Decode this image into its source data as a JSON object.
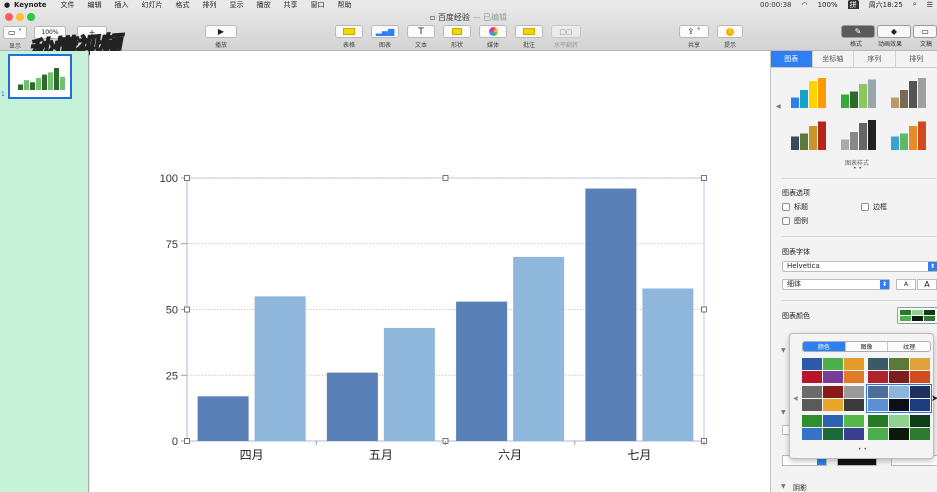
{
  "menubar": {
    "app": "Keynote",
    "items": [
      "文件",
      "编辑",
      "插入",
      "幻灯片",
      "格式",
      "排列",
      "显示",
      "播放",
      "共享",
      "窗口",
      "帮助"
    ],
    "status_time": "00:00:38",
    "battery": "100%",
    "input_method": "拼",
    "clock": "周六18:25"
  },
  "toolbar": {
    "view_label": "显示",
    "zoom_value": "100%",
    "play_label": "播放",
    "table_label": "表格",
    "chart_label": "图表",
    "text_label": "文本",
    "shape_label": "形状",
    "media_label": "媒体",
    "comment_label": "批注",
    "guides_label": "水平翻转",
    "share_label": "共享",
    "tips_label": "提示",
    "format_label": "格式",
    "animate_label": "动画效果",
    "document_label": "文稿"
  },
  "document": {
    "title": "百度经验",
    "edited": "— 已编辑"
  },
  "watermark": "秒懂视频",
  "slide_number": "1",
  "chart_data": {
    "type": "bar",
    "categories": [
      "四月",
      "五月",
      "六月",
      "七月"
    ],
    "series": [
      {
        "values": [
          17,
          26,
          53,
          96
        ]
      },
      {
        "values": [
          55,
          43,
          70,
          58
        ]
      }
    ],
    "yticks": [
      0,
      25,
      50,
      75,
      100
    ],
    "ylim": [
      0,
      100
    ],
    "colors": [
      "#5a80b8",
      "#8fb7db"
    ],
    "grid": true
  },
  "thumbnail_bars": [
    {
      "h": 0.25,
      "color": "#2c6b2c"
    },
    {
      "h": 0.45,
      "color": "#70c170"
    },
    {
      "h": 0.35,
      "color": "#2c6b2c"
    },
    {
      "h": 0.55,
      "color": "#70c170"
    },
    {
      "h": 0.7,
      "color": "#2c6b2c"
    },
    {
      "h": 0.8,
      "color": "#70c170"
    },
    {
      "h": 1.0,
      "color": "#2c6b2c"
    },
    {
      "h": 0.6,
      "color": "#70c170"
    }
  ],
  "inspector": {
    "tabs": [
      "图表",
      "坐标轴",
      "序列",
      "排列"
    ],
    "styles_caption": "图表样式",
    "options_title": "图表选项",
    "opt_title": "标题",
    "opt_border": "边框",
    "opt_legend": "图例",
    "font_title": "图表字体",
    "font_name": "Helvetica",
    "font_style": "细体",
    "font_small": "A",
    "font_large": "A",
    "color_title": "图表颜色",
    "shadow_label": "阴影"
  },
  "color_popover": {
    "tabs": [
      "颜色",
      "图像",
      "纹理"
    ],
    "palettes": [
      [
        "#2d5aa8",
        "#4caf4c",
        "#e39b2a",
        "#b5162b",
        "#7a3d97",
        "#e07c29"
      ],
      [
        "#3c5a66",
        "#5b7a3a",
        "#e0a23a",
        "#b0232a",
        "#7d1e1e",
        "#d24b1e"
      ],
      [
        "#6c6c6c",
        "#8a1a1a",
        "#9a9a9a",
        "#5a5a5a",
        "#e8a72a",
        "#3a3a3a"
      ],
      [
        "#4d6f99",
        "#8cb4dc",
        "#1d2f5a",
        "#5b8fd1",
        "#0a0f1a",
        "#1b3d80"
      ],
      [
        "#2e8f2e",
        "#2c62b0",
        "#56b84a",
        "#3572c8",
        "#1c6a3a",
        "#3a3e91"
      ],
      [
        "#247b24",
        "#8fd18f",
        "#0e3d1a",
        "#4cae4c",
        "#0a1a0a",
        "#2f7a2f"
      ]
    ]
  },
  "styles_grid": [
    [
      "#2d7ff2",
      "#17a3c7",
      "#ffd400",
      "#ff9a00"
    ],
    [
      "#39a939",
      "#2c6b2c",
      "#87c95f",
      "#9aa5ad"
    ],
    [
      "#b89b6b",
      "#7a6a55",
      "#555",
      "#a0a0a0"
    ],
    [
      "#3b4a5a",
      "#5d7a3a",
      "#c9952a",
      "#b7231d"
    ],
    [
      "#aaa",
      "#888",
      "#666",
      "#222"
    ],
    [
      "#3aa3d6",
      "#62b862",
      "#e78b2c",
      "#d14a1e"
    ]
  ]
}
